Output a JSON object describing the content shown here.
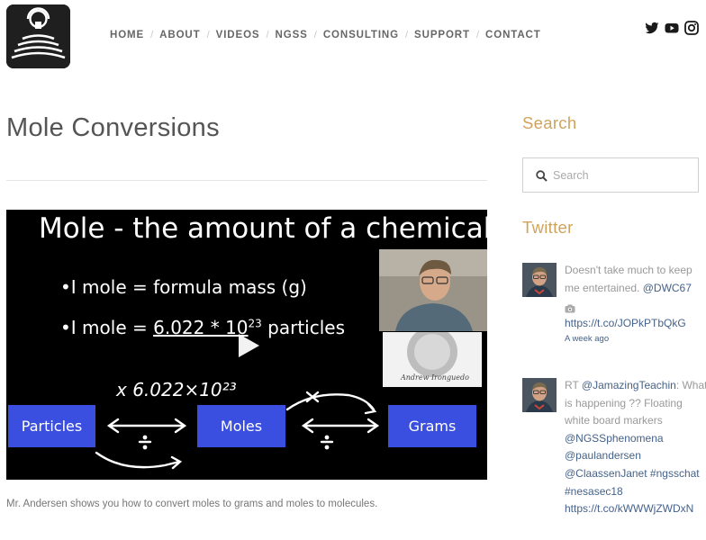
{
  "nav": {
    "items": [
      {
        "label": "HOME"
      },
      {
        "label": "ABOUT"
      },
      {
        "label": "VIDEOS"
      },
      {
        "label": "NGSS"
      },
      {
        "label": "CONSULTING"
      },
      {
        "label": "SUPPORT"
      },
      {
        "label": "CONTACT"
      }
    ],
    "separator": "/"
  },
  "social": {
    "icons": [
      "twitter-icon",
      "youtube-icon",
      "instagram-icon"
    ]
  },
  "page": {
    "title": "Mole Conversions",
    "caption": "Mr. Andersen shows you how to convert moles to grams and moles to molecules."
  },
  "video": {
    "heading": "Mole - the amount of a chemical",
    "bullet1": "•I mole = formula mass (g)",
    "bullet2_prefix": "•I mole = ",
    "bullet2_number": "6.022 * 10",
    "bullet2_exponent": "23",
    "bullet2_suffix": " particles",
    "handwritten": "x 6.022×10²³",
    "box_particles": "Particles",
    "box_moles": "Moles",
    "box_grams": "Grams",
    "signature": "Andrew Ironguedo",
    "play_icon": "play-icon"
  },
  "sidebar": {
    "search_title": "Search",
    "search_placeholder": "Search",
    "twitter_title": "Twitter"
  },
  "tweets": [
    {
      "line1": "Doesn't take much to keep me entertained. ",
      "mention": "@DWC67",
      "link": "https://t.co/JOPkPTbQkG",
      "time": "A week ago"
    },
    {
      "prefix": "RT ",
      "mention": "@JamazingTeachin",
      "text": ": What is happening ?? Floating white board markers",
      "mention2": "@NGSSphenomena",
      "mention3": "@paulandersen",
      "mention4": "@ClaassenJanet",
      "hashtag1": "#ngsschat",
      "hashtag2": "#nesasec18",
      "link": "https://t.co/kWWWjZWDxN"
    }
  ],
  "colors": {
    "accent": "#cfa35c",
    "link": "#45628a",
    "video_box": "#3a4fe0",
    "logo_bg": "#1f1f1f"
  }
}
